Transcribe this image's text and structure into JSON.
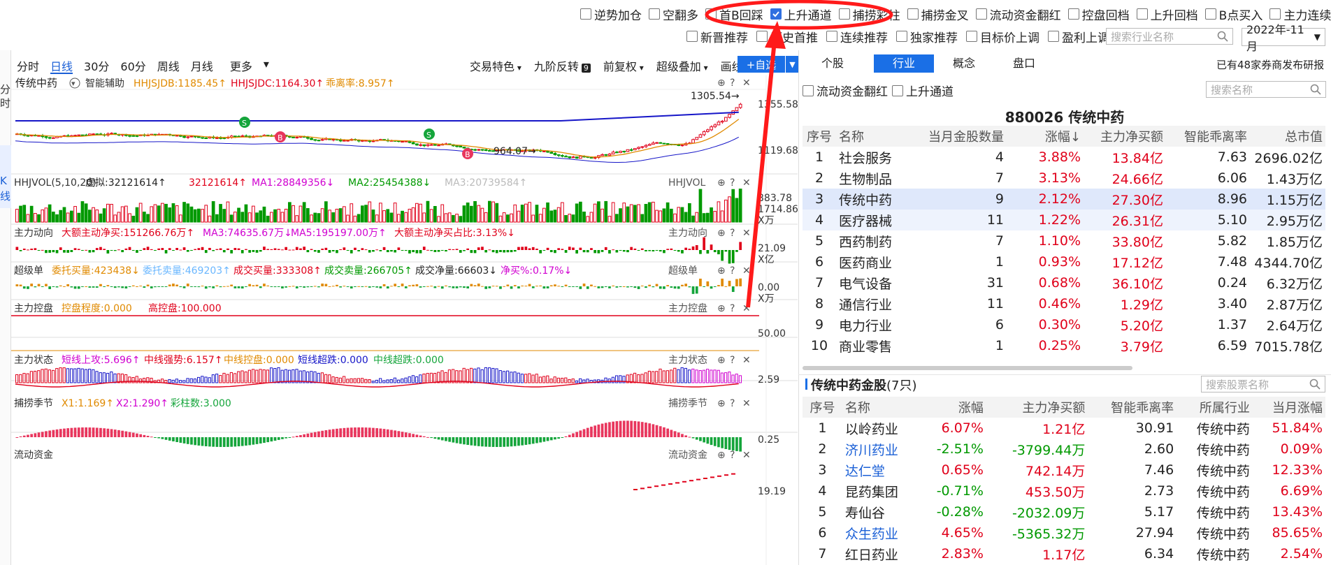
{
  "top_filters_row1": [
    {
      "label": "逆势加仓",
      "checked": false
    },
    {
      "label": "空翻多",
      "checked": false
    },
    {
      "label": "首B回踩",
      "checked": false
    },
    {
      "label": "上升通道",
      "checked": true
    },
    {
      "label": "捕捞彩柱",
      "checked": false
    },
    {
      "label": "捕捞金叉",
      "checked": false
    },
    {
      "label": "流动资金翻红",
      "checked": false
    },
    {
      "label": "控盘回档",
      "checked": false
    },
    {
      "label": "上升回档",
      "checked": false
    },
    {
      "label": "B点买入",
      "checked": false
    },
    {
      "label": "主力连续控盘",
      "checked": false
    }
  ],
  "top_filters_row2": [
    {
      "label": "新晋推荐",
      "checked": false
    },
    {
      "label": "历史首推",
      "checked": false
    },
    {
      "label": "连续推荐",
      "checked": false
    },
    {
      "label": "独家推荐",
      "checked": false
    },
    {
      "label": "目标价上调",
      "checked": false
    },
    {
      "label": "盈利上调",
      "checked": false
    }
  ],
  "industry_search_placeholder": "搜索行业名称",
  "month_select": "2022年-11月",
  "left_strip": {
    "a": "分",
    "b": "时",
    "c": "K",
    "d": "线"
  },
  "period_tabs": [
    "分时",
    "日线",
    "30分",
    "60分",
    "周线",
    "月线",
    "更多"
  ],
  "toolbar_items": [
    "交易特色",
    "九阶反转",
    "前复权",
    "超级叠加",
    "画线"
  ],
  "toolbar_badge": "9",
  "add_watch": "+自选",
  "chart_main": {
    "name": "传统中药",
    "assist": "智能辅助",
    "i1": "HHJSJDB:1185.45",
    "i2": "HHJSJDC:1164.30",
    "i3": "乖离率:8.957",
    "y_labels": [
      "1355.58",
      "1119.68",
      "883.78"
    ],
    "high_label": "1305.54",
    "low_label": "964.07"
  },
  "vol_panel": {
    "name": "HHJVOL(5,10,20)",
    "v1": "虚拟:32121614",
    "v2": "32121614",
    "ma1": "MA1:28849356",
    "ma2": "MA2:25454388",
    "ma3": "MA3:20739584",
    "tag": "HHJVOL",
    "y": "1714.86",
    "unit": "X万"
  },
  "zldx_panel": {
    "name": "主力动向",
    "a": "大额主动净买:151266.76万",
    "b": "MA3:74635.67万",
    "c": "MA5:195197.00万",
    "d": "大额主动净买占比:3.13%",
    "tag": "主力动向",
    "y": "21.09",
    "unit": "X亿"
  },
  "cjd_panel": {
    "name": "超级单",
    "a": "委托买量:423438",
    "b": "委托卖量:469203",
    "c": "成交买量:333308",
    "d": "成交卖量:266705",
    "e": "成交净量:66603",
    "f": "净买%:0.17%",
    "tag": "超级单",
    "y": "0.00",
    "unit": "X万"
  },
  "zlkp_panel": {
    "name": "主力控盘",
    "a": "控盘程度:0.000",
    "b": "高控盘:100.000",
    "tag": "主力控盘",
    "y": "50.00"
  },
  "zlzt_panel": {
    "name": "主力状态",
    "a": "短线上攻:5.696",
    "b": "中线强势:6.157",
    "c": "中线控盘:0.000",
    "d": "短线超跌:0.000",
    "e": "中线超跌:0.000",
    "tag": "主力状态",
    "y": "2.59"
  },
  "bljj_panel": {
    "name": "捕捞季节",
    "a": "X1:1.169",
    "b": "X2:1.290",
    "c": "彩柱数:3.000",
    "tag": "捕捞季节",
    "y": "0.25"
  },
  "ldzj_panel": {
    "name": "流动资金",
    "tag": "流动资金",
    "y": "19.19"
  },
  "right_tabs": [
    "个股",
    "行业",
    "概念",
    "盘口"
  ],
  "report_note": "已有48家券商发布研报",
  "right_filters": [
    {
      "label": "流动资金翻红",
      "checked": false
    },
    {
      "label": "上升通道",
      "checked": false
    }
  ],
  "name_search_placeholder": "搜索名称",
  "industry_title": "880026  传统中药",
  "industry_headers": [
    "序号",
    "名称",
    "当月金股数量",
    "涨幅↓",
    "主力净买额",
    "智能乖离率",
    "总市值"
  ],
  "industry_rows": [
    [
      "1",
      "社会服务",
      "4",
      "3.88%",
      "13.84亿",
      "7.63",
      "2696.02亿"
    ],
    [
      "2",
      "生物制品",
      "7",
      "3.13%",
      "24.66亿",
      "6.06",
      "1.43万亿"
    ],
    [
      "3",
      "传统中药",
      "9",
      "2.12%",
      "27.30亿",
      "8.96",
      "1.15万亿"
    ],
    [
      "4",
      "医疗器械",
      "11",
      "1.22%",
      "26.31亿",
      "5.10",
      "2.95万亿"
    ],
    [
      "5",
      "西药制药",
      "7",
      "1.10%",
      "33.80亿",
      "5.82",
      "1.85万亿"
    ],
    [
      "6",
      "医药商业",
      "1",
      "0.93%",
      "17.12亿",
      "7.48",
      "4344.70亿"
    ],
    [
      "7",
      "电气设备",
      "31",
      "0.68%",
      "36.10亿",
      "0.24",
      "6.32万亿"
    ],
    [
      "8",
      "通信行业",
      "11",
      "0.46%",
      "1.29亿",
      "3.40",
      "2.87万亿"
    ],
    [
      "9",
      "电力行业",
      "6",
      "0.30%",
      "5.20亿",
      "1.37",
      "2.64万亿"
    ],
    [
      "10",
      "商业零售",
      "1",
      "0.25%",
      "3.79亿",
      "6.59",
      "7015.78亿"
    ]
  ],
  "gold_title": "传统中药金股",
  "gold_count": "(7只)",
  "stock_search_placeholder": "搜索股票名称",
  "gold_headers": [
    "序号",
    "名称",
    "涨幅",
    "主力净买额",
    "智能乖离率",
    "所属行业",
    "当月涨幅"
  ],
  "gold_rows": [
    {
      "cells": [
        "1",
        "以岭药业",
        "6.07%",
        "1.21亿",
        "30.91",
        "传统中药",
        "51.84%"
      ],
      "link": false,
      "up": true,
      "flow_up": true
    },
    {
      "cells": [
        "2",
        "济川药业",
        "-2.51%",
        "-3799.44万",
        "2.60",
        "传统中药",
        "0.09%"
      ],
      "link": true,
      "up": false,
      "flow_up": false
    },
    {
      "cells": [
        "3",
        "达仁堂",
        "0.65%",
        "742.14万",
        "7.46",
        "传统中药",
        "12.33%"
      ],
      "link": true,
      "up": true,
      "flow_up": true
    },
    {
      "cells": [
        "4",
        "昆药集团",
        "-0.71%",
        "453.50万",
        "2.73",
        "传统中药",
        "6.69%"
      ],
      "link": false,
      "up": false,
      "flow_up": true
    },
    {
      "cells": [
        "5",
        "寿仙谷",
        "-0.28%",
        "-2032.09万",
        "5.17",
        "传统中药",
        "13.43%"
      ],
      "link": false,
      "up": false,
      "flow_up": false
    },
    {
      "cells": [
        "6",
        "众生药业",
        "4.65%",
        "-5365.32万",
        "27.94",
        "传统中药",
        "85.65%"
      ],
      "link": true,
      "up": true,
      "flow_up": false
    },
    {
      "cells": [
        "7",
        "红日药业",
        "2.83%",
        "1.17亿",
        "6.34",
        "传统中药",
        "2.54%"
      ],
      "link": false,
      "up": true,
      "flow_up": true
    }
  ],
  "colors": {
    "up": "#e0001a",
    "down": "#009900",
    "accent": "#1a6fe6",
    "annotation": "#ff1a1a"
  }
}
